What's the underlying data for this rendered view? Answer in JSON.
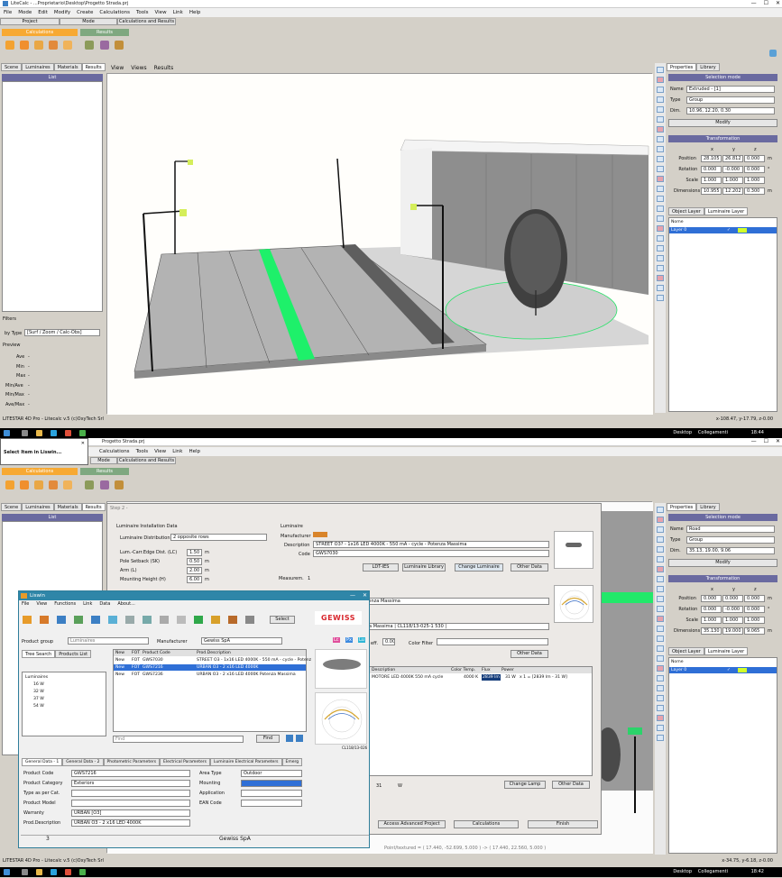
{
  "top": {
    "title": "LiteCalc - ...Proprietario\\Desktop\\Progetto Strada.prj",
    "menu": [
      "File",
      "Mode",
      "Edit",
      "Modify",
      "Create",
      "Calculations",
      "Tools",
      "View",
      "Link",
      "Help"
    ],
    "groups": [
      "Project",
      "Mode",
      "Calculations and Results"
    ],
    "ribbon_calc": "Calculations",
    "ribbon_results": "Results",
    "left_tabs": [
      "Scene",
      "Luminaires",
      "Materials",
      "Results"
    ],
    "list_header": "List",
    "filters_label": "Filters",
    "bytype_label": "by Type",
    "bytype_value": "[Surf / Zoom / Calc-Obs]",
    "preview_label": "Preview",
    "preview_rows": [
      {
        "k": "Ave",
        "v": "-"
      },
      {
        "k": "Min",
        "v": "-"
      },
      {
        "k": "Max",
        "v": "-"
      },
      {
        "k": "Min/Ave",
        "v": "-"
      },
      {
        "k": "Min/Max",
        "v": "-"
      },
      {
        "k": "Ave/Max",
        "v": "-"
      }
    ],
    "view_menu": [
      "View",
      "Views",
      "Results"
    ],
    "right_tabs": [
      "Properties",
      "Library"
    ],
    "selection_mode": "Selection mode",
    "props": [
      {
        "k": "Name",
        "v": "Extruded - [1]"
      },
      {
        "k": "Type",
        "v": "Group"
      },
      {
        "k": "Dim.",
        "v": "10.96, 12.20, 0.30"
      }
    ],
    "modify": "Modify",
    "transformation": "Transformation",
    "xyz": [
      "x",
      "y",
      "z"
    ],
    "transform_rows": [
      {
        "k": "Position",
        "v": [
          "28.105",
          "26.812",
          "0.000"
        ],
        "u": "m"
      },
      {
        "k": "Rotation",
        "v": [
          "0.000",
          "-0.000",
          "0.000"
        ],
        "u": "°"
      },
      {
        "k": "Scale",
        "v": [
          "1.000",
          "1.000",
          "1.000"
        ],
        "u": ""
      },
      {
        "k": "Dimensions",
        "v": [
          "10.955",
          "12.202",
          "0.300"
        ],
        "u": "m"
      }
    ],
    "layer_tabs": [
      "Object Layer",
      "Luminaire Layer"
    ],
    "layer_header": "Nome",
    "layer_row": "Layer 0",
    "status_left": "LITESTAR 4D Pro - Litecalc v.5     (c)OxyTech Srl",
    "status_right": "x-108.47, y-17.79, z-0.00",
    "time": "18:44",
    "desktop": "Desktop",
    "links": "Collegamenti"
  },
  "bottom": {
    "title": "Progetto Strada.prj",
    "menu": [
      "Calculations",
      "Tools",
      "View",
      "Link",
      "Help"
    ],
    "mode_label": "Mode",
    "groups": [
      "Calculations and Results"
    ],
    "ribbon_calc": "Calculations",
    "ribbon_results": "Results",
    "left_tabs": [
      "Scene",
      "Luminaires",
      "Materials",
      "Results"
    ],
    "list_header": "List",
    "popup_title": "Select Item in Liswin...",
    "step2": "Step 2 -",
    "lid_header": "Luminaire Installation Data",
    "distribution_label": "Luminaire Distribution",
    "distribution_value": "2 opposite rows",
    "lid_fields": [
      {
        "k": "Lum.-Carr.Edge Dist. (LC)",
        "v": "1.50",
        "u": "m"
      },
      {
        "k": "Pole Setback (SK)",
        "v": "0.50",
        "u": "m"
      },
      {
        "k": "Arm (L)",
        "v": "2.00",
        "u": "m"
      },
      {
        "k": "Mounting Height (H)",
        "v": "6.00",
        "u": "m"
      }
    ],
    "luminaire_header": "Luminaire",
    "manufacturer_label": "Manufacturer",
    "description_label": "Description",
    "code_label": "Code",
    "description": "STREET O3? - 1x16 LED 4000K - 550 mA - cycle - Potenza Massima",
    "code": "GWS7030",
    "ldt_btn": "LDT-IES",
    "lib_btn": "Luminaire Library",
    "change_btn": "Change Luminaire",
    "other_btn": "Other Data",
    "measurem": "Measurem.",
    "measurem_v": "1",
    "desc2": "K - 550 mA - cycle - Potenza Massima",
    "desc3": "550 mA - cycle - Potenza Massima | CL118/13-025-1 530 |",
    "coeff_label": "eff.",
    "coeff_v": "0.00",
    "color_filter": "Color Filter",
    "other2": "Other Data",
    "table_headers": [
      "Description",
      "Color Temp.",
      "Flux",
      "Power"
    ],
    "table_row": {
      "desc": "MOTORE LED 4000K 550 mA cycle",
      "temp": "4000 K",
      "flux": "2839 lm",
      "power": "31 W",
      "extra": "x 1 = [2839 lm - 31 W]"
    },
    "bottom_w": "31",
    "bottom_wu": "W",
    "change_lamp": "Change Lamp",
    "other3": "Other Data",
    "access_btn": "Access Advanced Project",
    "calc_btn": "Calculations",
    "finish_btn": "Finish",
    "pivot_status": "Point/textured = ( 17.440, -52.699, 5.000 ) -> ( 17.440, 22.560, 5.000 )",
    "right_props": [
      {
        "k": "Name",
        "v": "Road"
      },
      {
        "k": "Type",
        "v": "Group"
      },
      {
        "k": "Dim.",
        "v": "35.13, 19.00, 9.06"
      }
    ],
    "transform_rows": [
      {
        "k": "Position",
        "v": [
          "0.000",
          "0.000",
          "0.000"
        ],
        "u": "m"
      },
      {
        "k": "Rotation",
        "v": [
          "0.000",
          "-0.000",
          "0.000"
        ],
        "u": "°"
      },
      {
        "k": "Scale",
        "v": [
          "1.000",
          "1.000",
          "1.000"
        ],
        "u": ""
      },
      {
        "k": "Dimensions",
        "v": [
          "35.130",
          "19.000",
          "9.065"
        ],
        "u": "m"
      }
    ],
    "status_left": "LITESTAR 4D Pro - Litecalc v.5     (c)OxyTech Srl",
    "status_right": "x-34.75, y-6.18, z-0.00",
    "time": "18:42",
    "desktop": "Desktop",
    "links": "Collegamenti",
    "photo_code": "CL118/13-026"
  },
  "liswin": {
    "title": "Liswin",
    "menu": [
      "File",
      "View",
      "Functions",
      "Link",
      "Data",
      "About..."
    ],
    "select_btn": "Select",
    "brand": "GEWISS",
    "product_group_label": "Product group",
    "product_group_v": "Luminaires",
    "manufacturer_label": "Manufacturer",
    "manufacturer_v": "Gewiss SpA",
    "tree_tabs": [
      "Tree Search",
      "Products List"
    ],
    "tree": [
      "Luminaires",
      "16 W",
      "32 W",
      "37 W",
      "54 W"
    ],
    "list_headers": [
      "New",
      "FOT",
      "Product Code",
      "Prod.Description"
    ],
    "rows": [
      {
        "n": "New",
        "f": "FOT",
        "c": "GWS7030",
        "d": "STREET O3 - 1x16 LED 4000K - 550 mA - cycle - Potenz"
      },
      {
        "n": "New",
        "f": "FOT",
        "c": "GWS7216",
        "d": "URBAN O3 - 2 x16 LED 4000K"
      },
      {
        "n": "New",
        "f": "FOT",
        "c": "GWS7236",
        "d": "URBAN O3 - 2 x16 LED 4000K Potenza Massima"
      }
    ],
    "find_placeholder": "Find",
    "find_btn": "Find",
    "bottom_tabs": [
      "General Data - 1",
      "General Data - 2",
      "Photometric Parameters",
      "Electrical Parameters",
      "Luminaire Electrical Parameters",
      "Emerg"
    ],
    "gd_fields": [
      {
        "k": "Product Code",
        "v": "GWS7216"
      },
      {
        "k": "Product Category",
        "v": "Exteriors"
      },
      {
        "k": "Type as per Cat.",
        "v": ""
      },
      {
        "k": "Product Model",
        "v": ""
      },
      {
        "k": "Warranty",
        "v": "URBAN [O3]"
      },
      {
        "k": "Prod.Description",
        "v": "URBAN O3 - 2 x16 LED 4000K"
      }
    ],
    "gd_right": [
      {
        "k": "Area Type",
        "v": "Outdoor"
      },
      {
        "k": "Mounting",
        "v": ""
      },
      {
        "k": "Application",
        "v": ""
      },
      {
        "k": "EAN Code",
        "v": ""
      }
    ],
    "status": [
      "3",
      "Gewiss SpA"
    ],
    "lc_badges": [
      "Lc",
      "Px",
      "Lu"
    ]
  }
}
